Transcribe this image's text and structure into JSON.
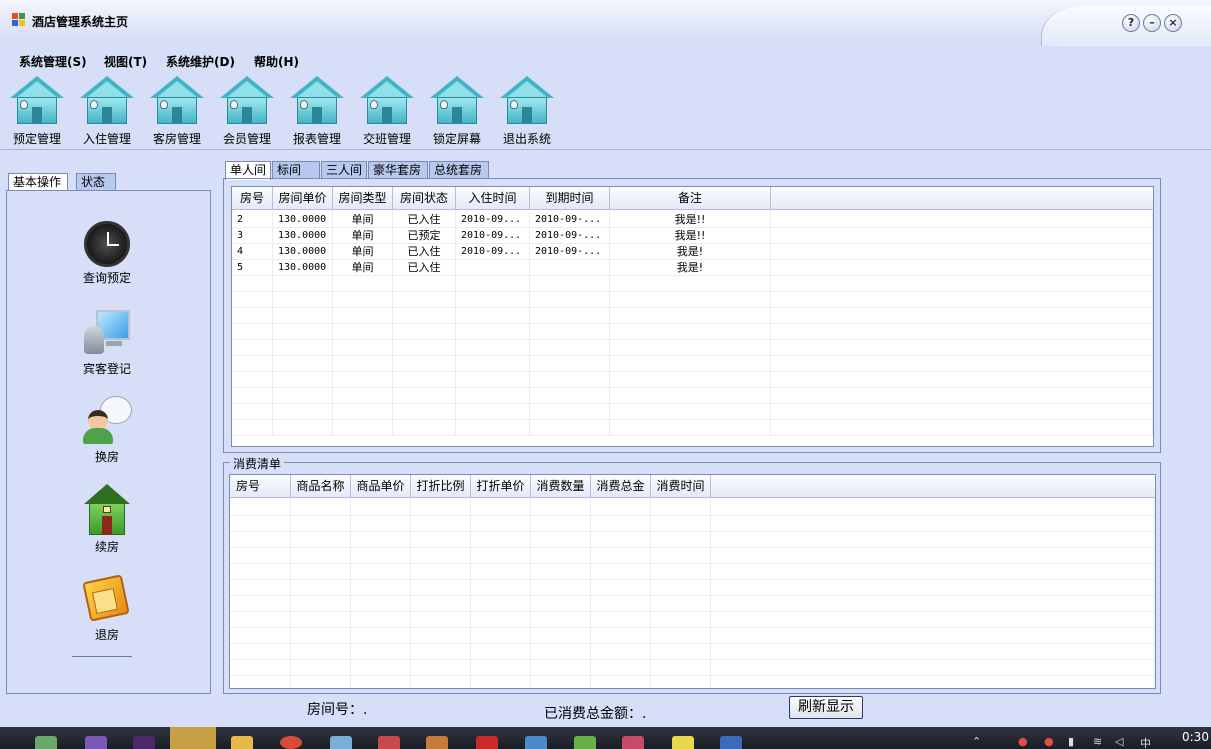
{
  "window": {
    "title": "酒店管理系统主页"
  },
  "title_buttons": {
    "help": "?",
    "minimize": "–",
    "close": "×"
  },
  "menu": [
    {
      "label": "系统管理(S)"
    },
    {
      "label": "视图(T)"
    },
    {
      "label": "系统维护(D)"
    },
    {
      "label": "帮助(H)"
    }
  ],
  "toolbar": [
    {
      "label": "预定管理"
    },
    {
      "label": "入住管理"
    },
    {
      "label": "客房管理"
    },
    {
      "label": "会员管理"
    },
    {
      "label": "报表管理"
    },
    {
      "label": "交班管理"
    },
    {
      "label": "锁定屏幕"
    },
    {
      "label": "退出系统"
    }
  ],
  "left_tabs": [
    {
      "label": "基本操作"
    },
    {
      "label": "状态"
    }
  ],
  "side_items": [
    {
      "label": "查询预定",
      "icon": "clock-icon"
    },
    {
      "label": "宾客登记",
      "icon": "monitor-person-icon"
    },
    {
      "label": "换房",
      "icon": "user-chat-icon"
    },
    {
      "label": "续房",
      "icon": "green-house-icon"
    },
    {
      "label": "退房",
      "icon": "orange-house-icon"
    }
  ],
  "room_tabs": [
    {
      "label": "单人间"
    },
    {
      "label": "标间"
    },
    {
      "label": "三人间"
    },
    {
      "label": "豪华套房"
    },
    {
      "label": "总统套房"
    }
  ],
  "rooms_table": {
    "columns": [
      "房号",
      "房间单价",
      "房间类型",
      "房间状态",
      "入住时间",
      "到期时间",
      "备注"
    ],
    "rows": [
      [
        "2",
        "130.0000",
        "单间",
        "已入住",
        "2010-09...",
        "2010-09-...",
        "我是!!"
      ],
      [
        "3",
        "130.0000",
        "单间",
        "已预定",
        "2010-09...",
        "2010-09-...",
        "我是!!"
      ],
      [
        "4",
        "130.0000",
        "单间",
        "已入住",
        "2010-09...",
        "2010-09-...",
        "我是!"
      ],
      [
        "5",
        "130.0000",
        "单间",
        "已入住",
        "",
        "",
        "我是!"
      ]
    ]
  },
  "consumption": {
    "legend": "消费清单",
    "columns": [
      "房号",
      "商品名称",
      "商品单价",
      "打折比例",
      "打折单价",
      "消费数量",
      "消费总金",
      "消费时间"
    ],
    "rows": []
  },
  "status": {
    "room_no": "房间号：.",
    "total": "已消费总金额：.",
    "refresh": "刷新显示"
  },
  "taskbar": {
    "time": "0:30",
    "ime": "中"
  },
  "colors": {
    "window_bg": "#d6dff7",
    "tab_bg": "#b9c8ee",
    "border": "#7b8bb6",
    "taskbar": "#1a1d24"
  }
}
